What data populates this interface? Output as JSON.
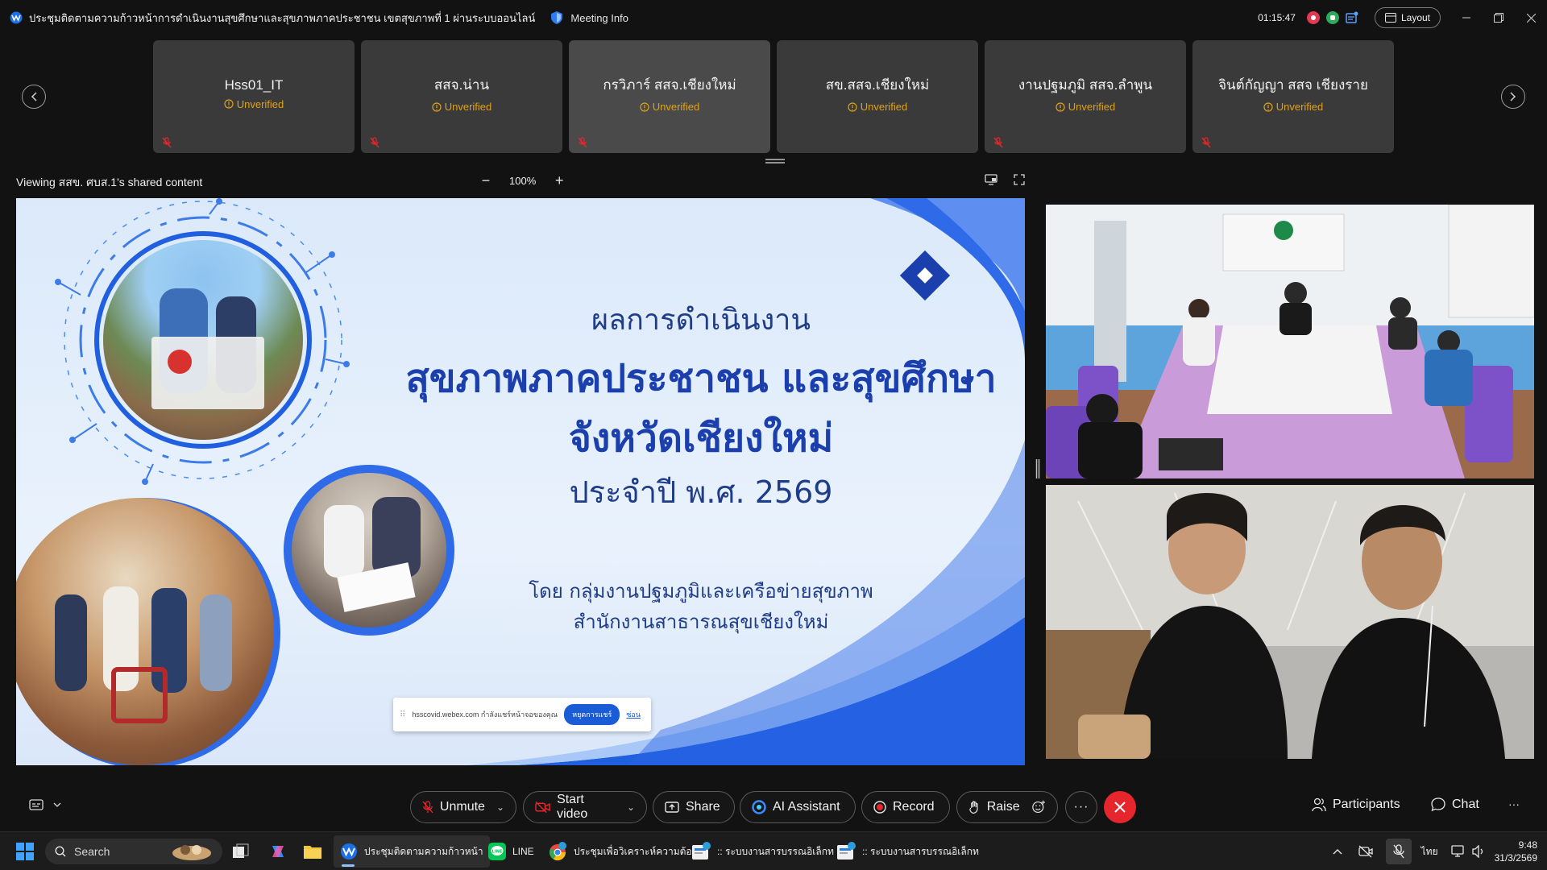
{
  "window": {
    "title": "ประชุมติดตามความก้าวหน้าการดำเนินงานสุขศึกษาและสุขภาพภาคประชาชน เขตสุขภาพที่ 1 ผ่านระบบออนไลน์",
    "meeting_info": "Meeting Info",
    "timer": "01:15:47",
    "layout_label": "Layout"
  },
  "participants": [
    {
      "name": "Hss01_IT",
      "status": "Unverified"
    },
    {
      "name": "สสจ.น่าน",
      "status": "Unverified"
    },
    {
      "name": "กรวิภาร์ สสจ.เชียงใหม่",
      "status": "Unverified"
    },
    {
      "name": "สข.สสจ.เชียงใหม่",
      "status": "Unverified"
    },
    {
      "name": "งานปฐมภูมิ สสจ.ลำพูน",
      "status": "Unverified"
    },
    {
      "name": "จินต์กัญญา สสจ เชียงราย",
      "status": "Unverified"
    }
  ],
  "share": {
    "viewing_label": "Viewing สสข. ศบส.1's shared content",
    "zoom": "100%"
  },
  "slide": {
    "line1": "ผลการดำเนินงาน",
    "line2": "สุขภาพภาคประชาชน และสุขศึกษา",
    "line3": "จังหวัดเชียงใหม่",
    "line4": "ประจำปี พ.ศ. 2569",
    "line5": "โดย กลุ่มงานปฐมภูมิและเครือข่ายสุขภาพ",
    "line6": "สำนักงานสาธารณสุขเชียงใหม่",
    "share_popup_text": "hsscovid.webex.com กำลังแชร์หน้าจอของคุณ",
    "share_popup_stop": "หยุดการแชร์",
    "share_popup_hide": "ซ่อน"
  },
  "controls": {
    "unmute": "Unmute",
    "start_video": "Start video",
    "share": "Share",
    "ai_assistant": "AI Assistant",
    "record": "Record",
    "raise": "Raise",
    "participants": "Participants",
    "chat": "Chat"
  },
  "taskbar": {
    "search": "Search",
    "apps": [
      {
        "label": "ประชุมติดตามความก้าวหน้า"
      },
      {
        "label": "LINE"
      },
      {
        "label": "ประชุมเพื่อวิเคราะห์ความต้อง"
      },
      {
        "label": ":: ระบบงานสารบรรณอิเล็กท"
      },
      {
        "label": ":: ระบบงานสารบรรณอิเล็กท"
      }
    ],
    "lang": "ไทย",
    "time": "9:48",
    "date": "31/3/2569"
  },
  "colors": {
    "accent": "#1c3fae",
    "unverified": "#e0a11a",
    "end_call": "#e5262c"
  }
}
